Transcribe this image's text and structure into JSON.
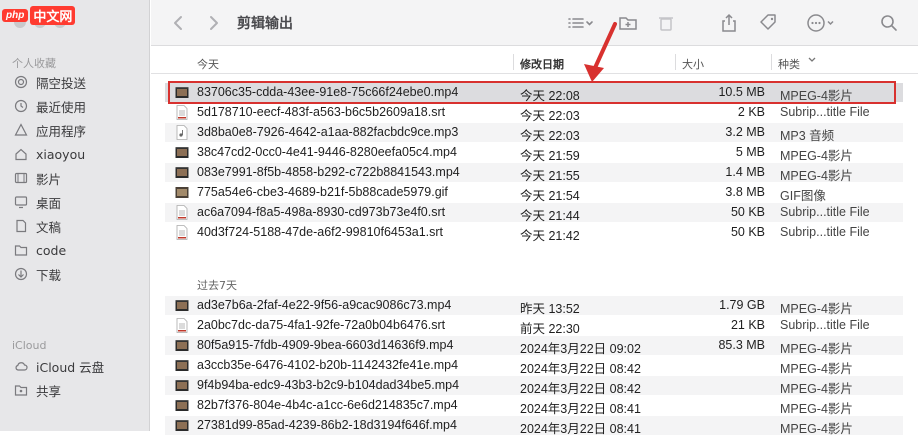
{
  "watermark": {
    "badge": "php",
    "text": "中文网"
  },
  "sidebar": {
    "favorites_title": "个人收藏",
    "favorites": [
      {
        "label": "隔空投送",
        "icon": "airdrop-icon"
      },
      {
        "label": "最近使用",
        "icon": "clock-icon"
      },
      {
        "label": "应用程序",
        "icon": "apps-icon"
      },
      {
        "label": "xiaoyou",
        "icon": "home-icon"
      },
      {
        "label": "影片",
        "icon": "film-icon"
      },
      {
        "label": "桌面",
        "icon": "desktop-icon"
      },
      {
        "label": "文稿",
        "icon": "document-icon"
      },
      {
        "label": "code",
        "icon": "folder-icon"
      },
      {
        "label": "下载",
        "icon": "download-icon"
      }
    ],
    "icloud_title": "iCloud",
    "icloud": [
      {
        "label": "iCloud 云盘",
        "icon": "cloud-icon"
      },
      {
        "label": "共享",
        "icon": "shared-folder-icon"
      }
    ]
  },
  "toolbar": {
    "title": "剪辑输出"
  },
  "columns": {
    "name": "今天",
    "date": "修改日期",
    "size": "大小",
    "kind": "种类"
  },
  "groups": [
    {
      "label": "今天",
      "rows": [
        {
          "name": "83706c35-cdda-43ee-91e8-75c66f24ebe0.mp4",
          "date": "今天 22:08",
          "size": "10.5 MB",
          "kind": "MPEG-4影片",
          "icon": "video-icon"
        },
        {
          "name": "5d178710-eecf-483f-a563-b6c5b2609a18.srt",
          "date": "今天 22:03",
          "size": "2 KB",
          "kind": "Subrip...title File",
          "icon": "text-file-icon"
        },
        {
          "name": "3d8ba0e8-7926-4642-a1aa-882facbdc9ce.mp3",
          "date": "今天 22:03",
          "size": "3.2 MB",
          "kind": "MP3 音频",
          "icon": "audio-file-icon"
        },
        {
          "name": "38c47cd2-0cc0-4e41-9446-8280eefa05c4.mp4",
          "date": "今天 21:59",
          "size": "5 MB",
          "kind": "MPEG-4影片",
          "icon": "video-icon"
        },
        {
          "name": "083e7991-8f5b-4858-b292-c722b8841543.mp4",
          "date": "今天 21:55",
          "size": "1.4 MB",
          "kind": "MPEG-4影片",
          "icon": "video-icon"
        },
        {
          "name": "775a54e6-cbe3-4689-b21f-5b88cade5979.gif",
          "date": "今天 21:54",
          "size": "3.8 MB",
          "kind": "GIF图像",
          "icon": "image-file-icon"
        },
        {
          "name": "ac6a7094-f8a5-498a-8930-cd973b73e4f0.srt",
          "date": "今天 21:44",
          "size": "50 KB",
          "kind": "Subrip...title File",
          "icon": "text-file-icon"
        },
        {
          "name": "40d3f724-5188-47de-a6f2-99810f6453a1.srt",
          "date": "今天 21:42",
          "size": "50 KB",
          "kind": "Subrip...title File",
          "icon": "text-file-icon"
        }
      ]
    },
    {
      "label": "过去7天",
      "rows": [
        {
          "name": "ad3e7b6a-2faf-4e22-9f56-a9cac9086c73.mp4",
          "date": "昨天 13:52",
          "size": "1.79 GB",
          "kind": "MPEG-4影片",
          "icon": "video-icon"
        },
        {
          "name": "2a0bc7dc-da75-4fa1-92fe-72a0b04b6476.srt",
          "date": "前天 22:30",
          "size": "21 KB",
          "kind": "Subrip...title File",
          "icon": "text-file-icon"
        },
        {
          "name": "80f5a915-7fdb-4909-9bea-6603d14636f9.mp4",
          "date": "2024年3月22日 09:02",
          "size": "85.3 MB",
          "kind": "MPEG-4影片",
          "icon": "video-icon"
        },
        {
          "name": "a3ccb35e-6476-4102-b20b-1142432fe41e.mp4",
          "date": "2024年3月22日 08:42",
          "size": "",
          "kind": "MPEG-4影片",
          "icon": "video-icon"
        },
        {
          "name": "9f4b94ba-edc9-43b3-b2c9-b104dad34be5.mp4",
          "date": "2024年3月22日 08:42",
          "size": "",
          "kind": "MPEG-4影片",
          "icon": "video-icon"
        },
        {
          "name": "82b7f376-804e-4b4c-a1cc-6e6d214835c7.mp4",
          "date": "2024年3月22日 08:41",
          "size": "",
          "kind": "MPEG-4影片",
          "icon": "video-icon"
        },
        {
          "name": "27381d99-85ad-4239-86b2-18d3194f646f.mp4",
          "date": "2024年3月22日 08:41",
          "size": "",
          "kind": "MPEG-4影片",
          "icon": "video-icon"
        }
      ]
    }
  ],
  "colors": {
    "highlight": "#d8312f",
    "sidebar_bg": "#e7e7e9",
    "selected_row": "#dcdcdf"
  }
}
